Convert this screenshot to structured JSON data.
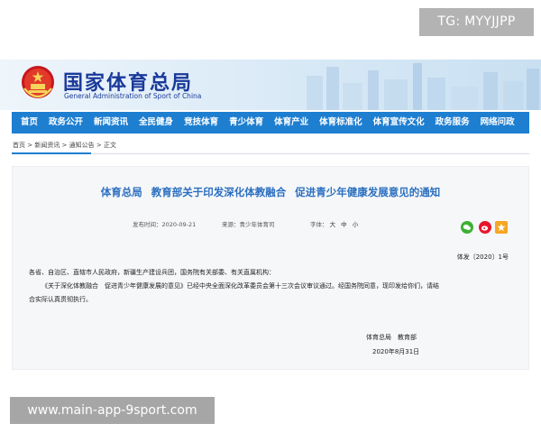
{
  "overlay": {
    "tg_badge": "TG: MYYJJPP",
    "url_badge": "www.main-app-9sport.com"
  },
  "header": {
    "title": "国家体育总局",
    "subtitle": "General Administration of Sport of China",
    "emblem_icon": "national-emblem-icon"
  },
  "nav": {
    "items": [
      "首页",
      "政务公开",
      "新闻资讯",
      "全民健身",
      "竞技体育",
      "青少体育",
      "体育产业",
      "体育标准化",
      "体育宣传文化",
      "政务服务",
      "网络问政"
    ]
  },
  "breadcrumb": "首页 > 新闻资讯 > 通知公告 > 正文",
  "article": {
    "title_part1": "体育总局",
    "title_part2": "教育部关于印发深化体教融合",
    "title_part3": "促进青少年健康发展意见的通知",
    "published": "发布时间：2020-09-21",
    "source": "来源：青少年体育司",
    "font_label": "字体：",
    "font_sizes": [
      "大",
      "中",
      "小"
    ],
    "share_icons": [
      "wechat-icon",
      "weibo-icon",
      "star-icon"
    ],
    "doc_number": "体发〔2020〕1号",
    "recipients": "各省、自治区、直辖市人民政府，新疆生产建设兵团，国务院有关部委、有关直属机构：",
    "body_line1": "《关于深化体教融合　促进青少年健康发展的意见》已经中央全面深化改革委员会第十三次会议审议通过。经国务院同意，现印发给你们，请结",
    "body_line2": "合实际认真贯彻执行。",
    "signature": "体育总局　教育部",
    "date": "2020年8月31日"
  },
  "colors": {
    "nav_bg": "#1e7fd1",
    "title_blue": "#2a6fc0",
    "brand_blue": "#1a3a9a"
  }
}
